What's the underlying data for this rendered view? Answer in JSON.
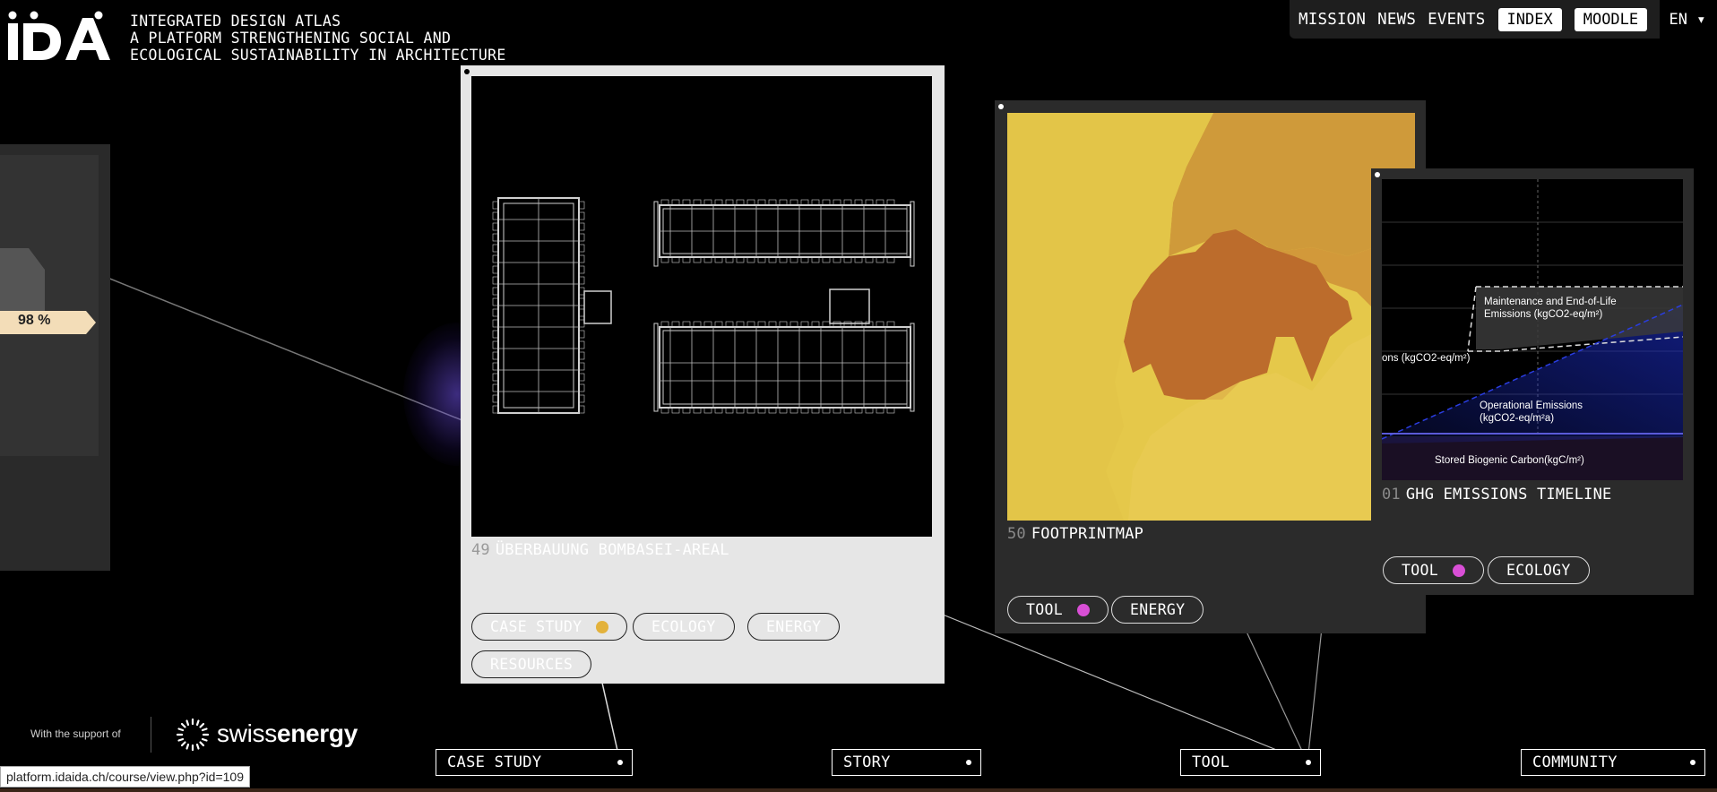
{
  "brand": {
    "logo_text": "IDA",
    "tagline": [
      "INTEGRATED DESIGN ATLAS",
      "A PLATFORM STRENGTHENING SOCIAL AND",
      "ECOLOGICAL SUSTAINABILITY IN ARCHITECTURE"
    ]
  },
  "topnav": {
    "links": [
      "MISSION",
      "NEWS",
      "EVENTS"
    ],
    "boxed": [
      "INDEX",
      "MOODLE"
    ],
    "language": "EN ▾"
  },
  "left_card": {
    "badge": "98 %"
  },
  "cards": [
    {
      "number": "49",
      "title": "ÜBERBAUUNG BOMBASEI-AREAL",
      "tags": [
        "CASE STUDY",
        "ECOLOGY",
        "ENERGY",
        "RESOURCES"
      ],
      "category_color": "#e3b23c"
    },
    {
      "number": "50",
      "title": "FOOTPRINTMAP",
      "tags": [
        "TOOL",
        "ENERGY"
      ],
      "category_color": "#d94fd6"
    },
    {
      "number": "01",
      "title": "GHG EMISSIONS TIMELINE",
      "tags": [
        "TOOL",
        "ECOLOGY"
      ],
      "category_color": "#d94fd6",
      "chart_labels": {
        "maintenance": [
          "Maintenance and End-of-Life",
          "Emissions (kgCO2-eq/m²)"
        ],
        "embodied_partial": "ons (kgCO2-eq/m²)",
        "operational": [
          "Operational Emissions",
          "(kgCO2-eq/m²a)"
        ],
        "biogenic": "Stored Biogenic Carbon(kgC/m²)"
      }
    }
  ],
  "footer": {
    "support_text": "With the support of",
    "swissenergy_light": "swiss",
    "swissenergy_bold": "energy"
  },
  "bottom_nav": [
    "CASE STUDY",
    "STORY",
    "TOOL",
    "COMMUNITY"
  ],
  "status_url": "platform.idaida.ch/course/view.php?id=109"
}
